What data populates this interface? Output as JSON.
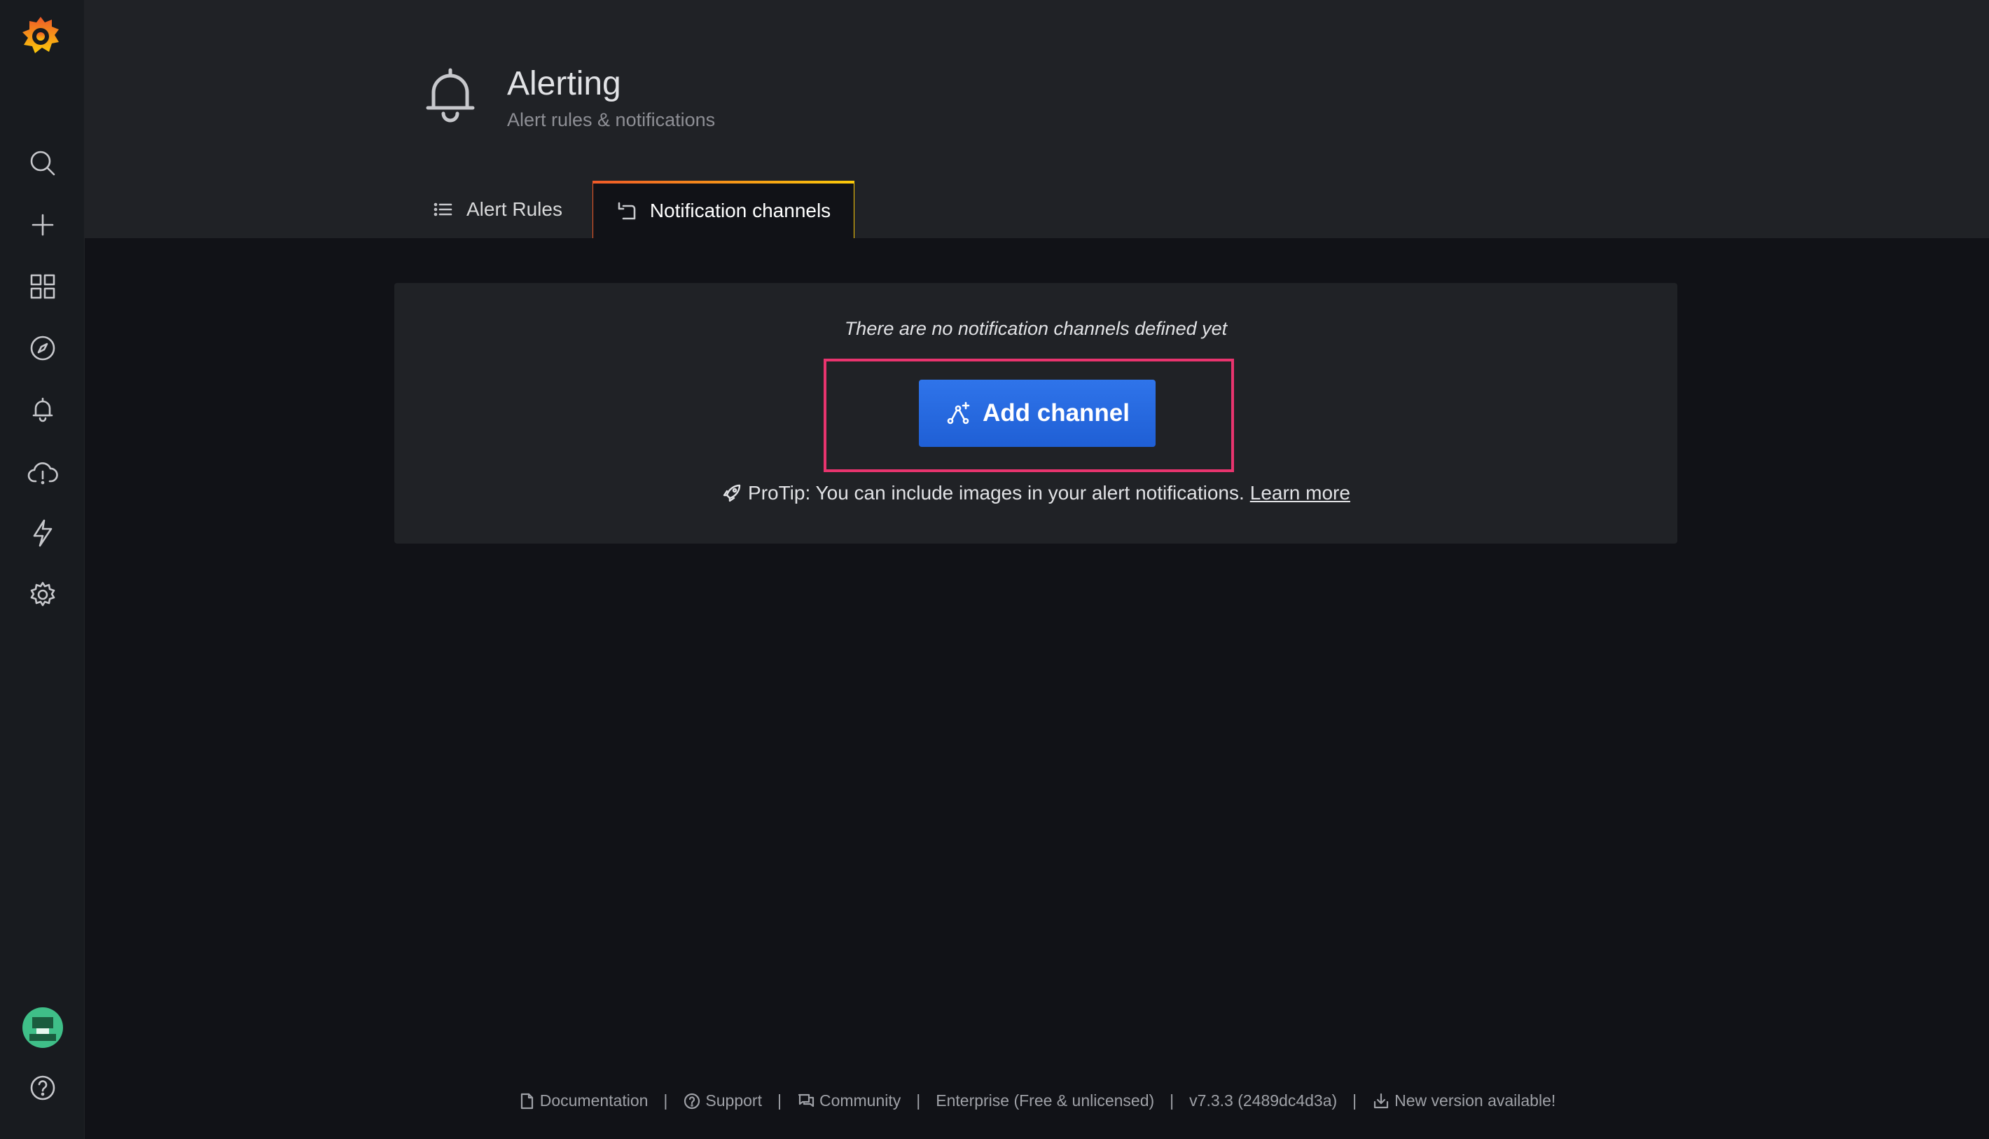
{
  "sidebar": {
    "items": [
      {
        "icon": "search-icon"
      },
      {
        "icon": "plus-icon"
      },
      {
        "icon": "dashboards-icon"
      },
      {
        "icon": "compass-icon"
      },
      {
        "icon": "bell-icon"
      },
      {
        "icon": "cloud-alert-icon"
      },
      {
        "icon": "bolt-icon"
      },
      {
        "icon": "gear-icon"
      }
    ]
  },
  "header": {
    "title": "Alerting",
    "subtitle": "Alert rules & notifications"
  },
  "tabs": [
    {
      "label": "Alert Rules",
      "icon": "list-icon",
      "active": false
    },
    {
      "label": "Notification channels",
      "icon": "channel-icon",
      "active": true
    }
  ],
  "empty_state": {
    "message": "There are no notification channels defined yet",
    "button_label": "Add channel",
    "protip_text": "ProTip: You can include images in your alert notifications.",
    "protip_link": "Learn more"
  },
  "footer": {
    "documentation": "Documentation",
    "support": "Support",
    "community": "Community",
    "edition": "Enterprise (Free & unlicensed)",
    "version": "v7.3.3 (2489dc4d3a)",
    "update": "New version available!"
  },
  "colors": {
    "accent": "#1f62e0",
    "highlight": "#e8346e",
    "tab_gradient_start": "#f05a28",
    "tab_gradient_end": "#fbca0a"
  }
}
